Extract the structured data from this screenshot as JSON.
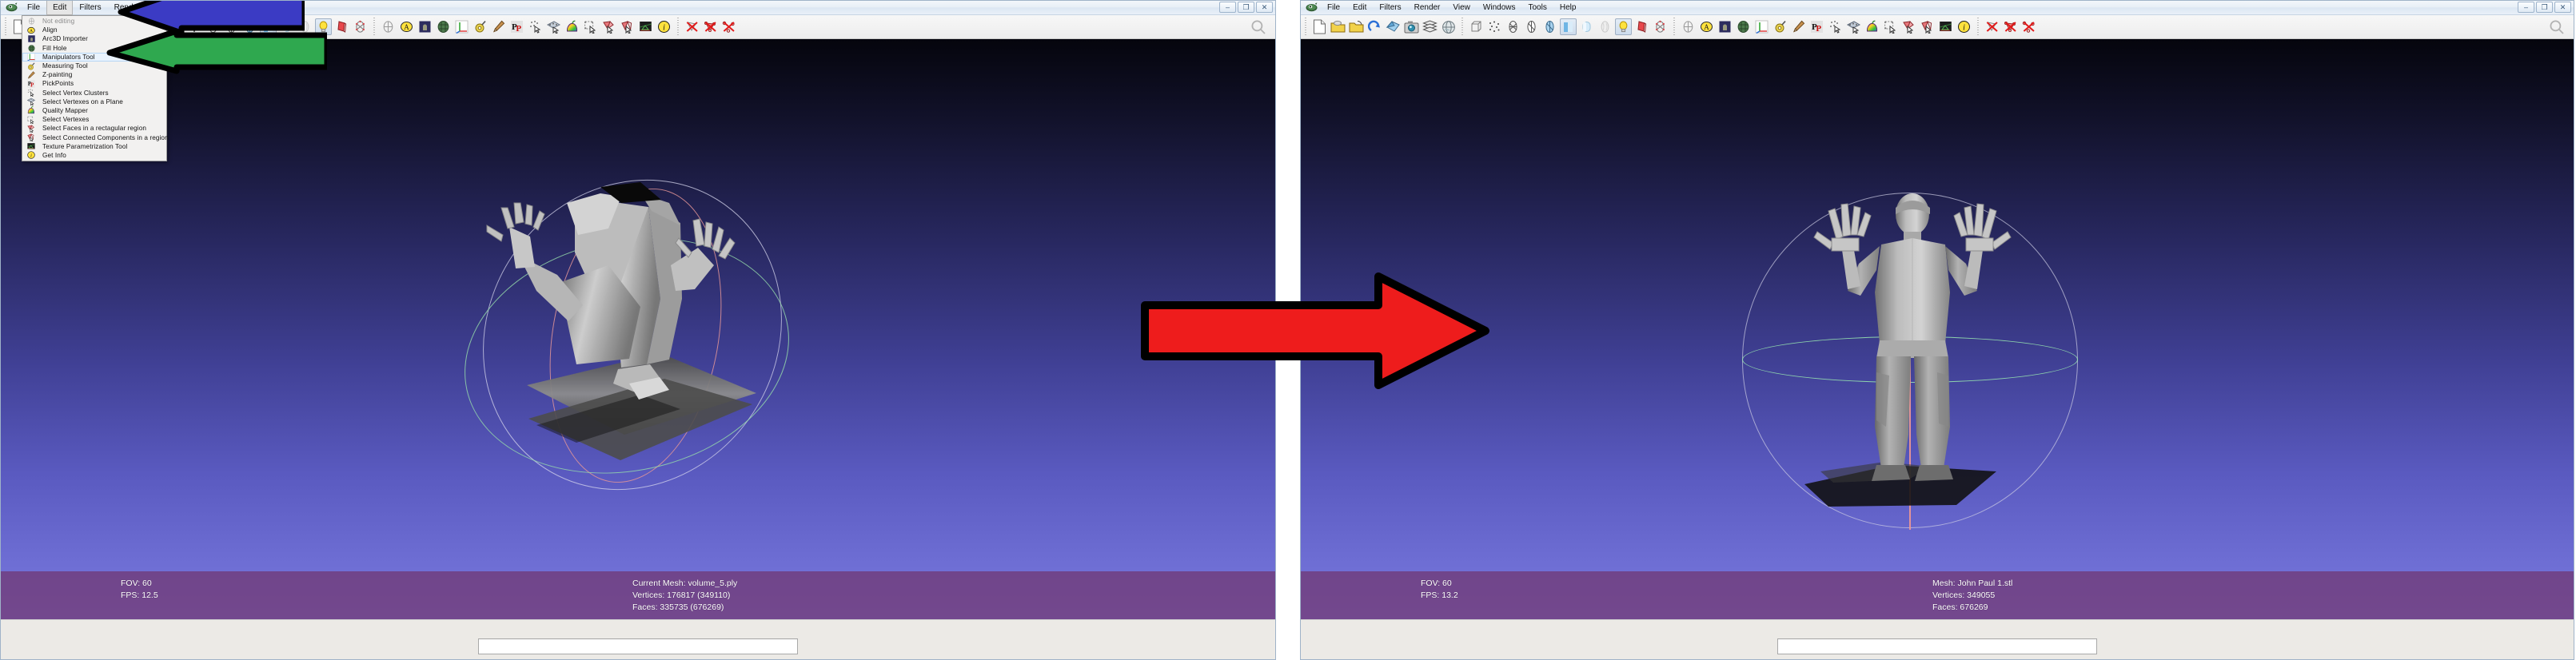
{
  "app": {
    "logo_icon": "meshlab-logo-icon",
    "window_buttons": [
      {
        "name": "minimize-button",
        "glyph": "–"
      },
      {
        "name": "restore-button",
        "glyph": "❐"
      },
      {
        "name": "close-button",
        "glyph": "✕"
      }
    ]
  },
  "menubar": {
    "items": [
      "File",
      "Edit",
      "Filters",
      "Render",
      "View",
      "Windows",
      "Tools",
      "Help"
    ],
    "open_index": 1
  },
  "toolbar": {
    "file_group": [
      {
        "name": "new-project-icon",
        "title": "New Project"
      },
      {
        "name": "open-project-icon",
        "title": "Open Project"
      },
      {
        "name": "open-mesh-icon",
        "title": "Import Mesh"
      },
      {
        "name": "reload-icon",
        "title": "Reload"
      },
      {
        "name": "save-mesh-icon",
        "title": "Save Mesh"
      },
      {
        "name": "snapshot-icon",
        "title": "Snapshot"
      },
      {
        "name": "layers-icon",
        "title": "Show Layer Dialog"
      },
      {
        "name": "globe-icon",
        "title": "Show Trackball"
      }
    ],
    "render_group": [
      {
        "name": "bbox-render-icon",
        "title": "Bounding Box",
        "pressed": false
      },
      {
        "name": "points-render-icon",
        "title": "Points",
        "pressed": false
      },
      {
        "name": "wire-render-icon",
        "title": "Wireframe",
        "pressed": false
      },
      {
        "name": "hidden-lines-icon",
        "title": "Hidden Lines",
        "pressed": false
      },
      {
        "name": "flat-lines-icon",
        "title": "Flat Lines",
        "pressed": false
      },
      {
        "name": "flat-render-icon",
        "title": "Flat",
        "pressed": true
      },
      {
        "name": "smooth-render-icon",
        "title": "Smooth",
        "pressed": false
      },
      {
        "name": "texture-render-icon",
        "title": "Texture",
        "pressed": false
      },
      {
        "name": "lighting-icon",
        "title": "Lighting",
        "pressed": true
      },
      {
        "name": "backface-cull-icon",
        "title": "Backface Culling",
        "pressed": false
      },
      {
        "name": "vertex-quality-icon",
        "title": "Vertex Quality",
        "pressed": false
      }
    ],
    "edit_group": [
      {
        "name": "not-editing-icon",
        "title": "Not editing"
      },
      {
        "name": "align-icon",
        "title": "Align"
      },
      {
        "name": "arc3d-importer-icon",
        "title": "Arc3D Importer"
      },
      {
        "name": "fill-hole-icon",
        "title": "Fill Hole"
      },
      {
        "name": "manipulators-tool-icon",
        "title": "Manipulators Tool"
      },
      {
        "name": "measuring-tool-icon",
        "title": "Measuring Tool"
      },
      {
        "name": "z-painting-icon",
        "title": "Z-painting"
      },
      {
        "name": "pickpoints-icon",
        "title": "PickPoints"
      },
      {
        "name": "select-vertex-clusters-icon",
        "title": "Select Vertex Clusters"
      },
      {
        "name": "select-vertexes-plane-icon",
        "title": "Select Vertexes on a Plane"
      },
      {
        "name": "quality-mapper-icon",
        "title": "Quality Mapper"
      },
      {
        "name": "select-vertexes-icon",
        "title": "Select Vertexes"
      },
      {
        "name": "select-faces-rect-icon",
        "title": "Select Faces in a rectagular region"
      },
      {
        "name": "select-connected-components-icon",
        "title": "Select Connected Components in a region"
      },
      {
        "name": "texture-param-tool-icon",
        "title": "Texture Parametrization Tool"
      },
      {
        "name": "get-info-icon",
        "title": "Get Info"
      }
    ],
    "delete_group": [
      {
        "name": "delete-faces-icon",
        "title": "Delete Selected Faces"
      },
      {
        "name": "delete-faces-vertices-icon",
        "title": "Delete Selected Faces and Vertices"
      },
      {
        "name": "delete-vertices-icon",
        "title": "Delete Selected Vertices"
      }
    ],
    "search_icon": "search-icon"
  },
  "edit_menu": {
    "items": [
      {
        "label": "Not editing",
        "icon": "not-editing-icon",
        "disabled": true,
        "highlighted": false
      },
      {
        "label": "Align",
        "icon": "align-icon",
        "disabled": false,
        "highlighted": false
      },
      {
        "label": "Arc3D Importer",
        "icon": "arc3d-importer-icon",
        "disabled": false,
        "highlighted": false
      },
      {
        "label": "Fill Hole",
        "icon": "fill-hole-icon",
        "disabled": false,
        "highlighted": false
      },
      {
        "label": "Manipulators Tool",
        "icon": "manipulators-tool-icon",
        "disabled": false,
        "highlighted": true
      },
      {
        "label": "Measuring Tool",
        "icon": "measuring-tool-icon",
        "disabled": false,
        "highlighted": false
      },
      {
        "label": "Z-painting",
        "icon": "z-painting-icon",
        "disabled": false,
        "highlighted": false
      },
      {
        "label": "PickPoints",
        "icon": "pickpoints-icon",
        "disabled": false,
        "highlighted": false
      },
      {
        "label": "Select Vertex Clusters",
        "icon": "select-vertex-clusters-icon",
        "disabled": false,
        "highlighted": false
      },
      {
        "label": "Select Vertexes on a Plane",
        "icon": "select-vertexes-plane-icon",
        "disabled": false,
        "highlighted": false
      },
      {
        "label": "Quality Mapper",
        "icon": "quality-mapper-icon",
        "disabled": false,
        "highlighted": false
      },
      {
        "label": "Select Vertexes",
        "icon": "select-vertexes-icon",
        "disabled": false,
        "highlighted": false
      },
      {
        "label": "Select Faces in a rectagular region",
        "icon": "select-faces-rect-icon",
        "disabled": false,
        "highlighted": false
      },
      {
        "label": "Select Connected Components in a region",
        "icon": "select-connected-components-icon",
        "disabled": false,
        "highlighted": false
      },
      {
        "label": "Texture Parametrization Tool",
        "icon": "texture-param-tool-icon",
        "disabled": false,
        "highlighted": false
      },
      {
        "label": "Get Info",
        "icon": "get-info-icon",
        "disabled": false,
        "highlighted": false
      }
    ]
  },
  "left_panel": {
    "status": {
      "fov_label": "FOV: 60",
      "fps_label": "FPS:  12.5",
      "mesh_label": "Current Mesh: volume_5.ply",
      "vertices_label": "Vertices: 176817 (349110)",
      "faces_label": "Faces: 335735 (676269)"
    }
  },
  "right_panel": {
    "status": {
      "fov_label": "FOV: 60",
      "fps_label": "FPS:  13.2",
      "mesh_label": "Mesh: John Paul 1.stl",
      "vertices_label": "Vertices: 349055",
      "faces_label": "Faces: 676269"
    }
  },
  "annotations": [
    {
      "name": "blue-arrow-annotation",
      "color": "#3b3bc4",
      "direction": "left",
      "points_to": "Edit menu"
    },
    {
      "name": "green-arrow-annotation",
      "color": "#2fa84f",
      "direction": "left",
      "points_to": "Manipulators Tool"
    },
    {
      "name": "red-arrow-annotation",
      "color": "#ee1c1c",
      "direction": "right",
      "points_to": "Result viewport"
    }
  ],
  "colors": {
    "status_bar": "#70346e",
    "viewport_top": "#05050d",
    "viewport_bottom": "#7b7be0",
    "menu_highlight": "#eaf3fd",
    "chrome": "#f0f0f0"
  }
}
